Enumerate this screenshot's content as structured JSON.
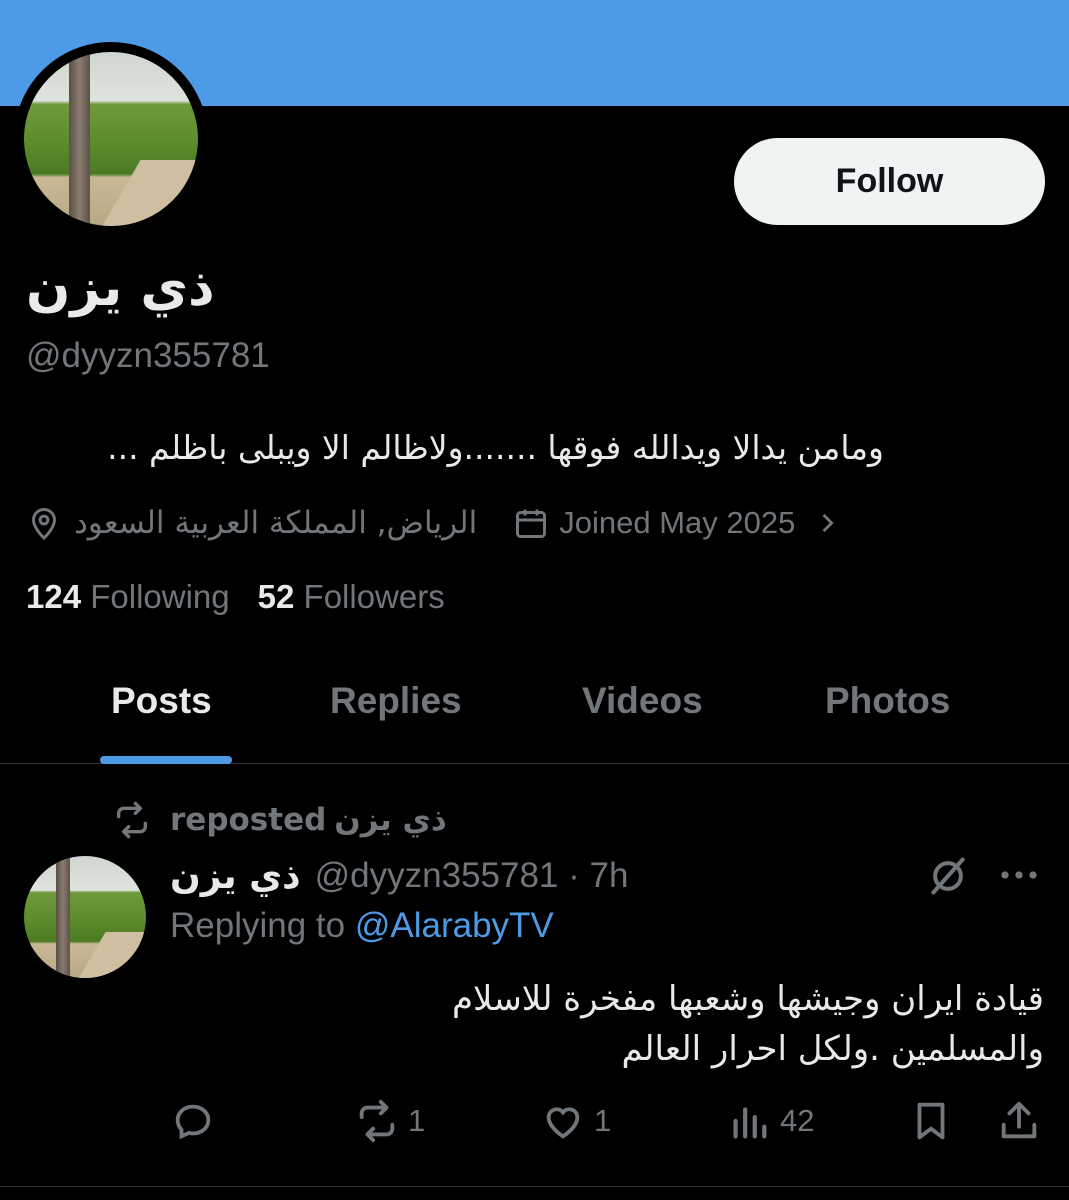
{
  "colors": {
    "accent": "#4d9be6",
    "background": "#000000",
    "text": "#e7e9ea",
    "muted": "#71767b"
  },
  "profile": {
    "display_name": "ذي يزن",
    "handle": "@dyyzn355781",
    "bio": "ومامن يدالا ويدالله فوقها .......ولاظالم الا ويبلى باظلم ...",
    "location": "الرياض, المملكة العربية السعود",
    "joined": "Joined May 2025",
    "follow_label": "Follow",
    "following_count": "124",
    "following_label": "Following",
    "followers_count": "52",
    "followers_label": "Followers"
  },
  "tabs": [
    {
      "label": "Posts",
      "active": true
    },
    {
      "label": "Replies",
      "active": false
    },
    {
      "label": "Videos",
      "active": false
    },
    {
      "label": "Photos",
      "active": false
    }
  ],
  "tweet": {
    "repost_who": "ذي يزن",
    "repost_label": "reposted",
    "author_name": "ذي يزن",
    "author_handle_time": "@dyyzn355781 · 7h",
    "replying_prefix": "Replying to",
    "replying_handle": "@AlarabyTV",
    "text_line1": "قيادة  ايران وجيشها وشعبها مفخرة للاسلام",
    "text_line2": "والمسلمين .ولكل احرار العالم",
    "retweets": "1",
    "likes": "1",
    "views": "42"
  },
  "icons": [
    "location-icon",
    "calendar-icon",
    "chevron-right-icon",
    "repost-icon",
    "grok-icon",
    "more-icon",
    "reply-icon",
    "retweet-icon",
    "like-icon",
    "views-icon",
    "bookmark-icon",
    "share-icon"
  ]
}
